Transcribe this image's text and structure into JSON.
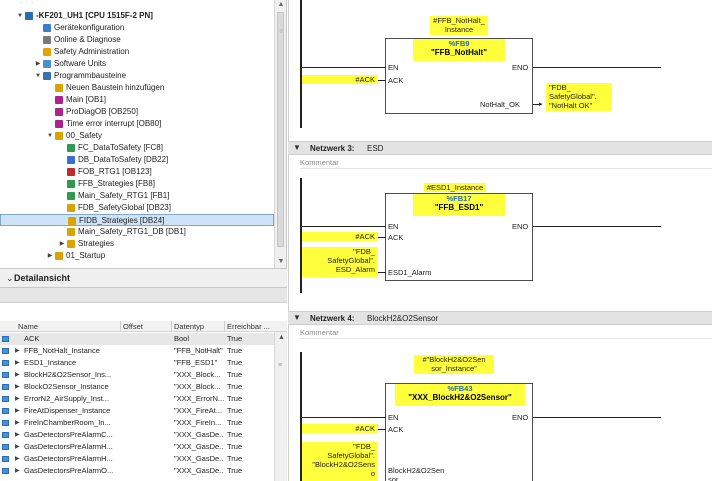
{
  "tree": {
    "items": [
      {
        "label": "-KF201_UH1 [CPU 1515F-2 PN]",
        "indent": 0,
        "twisty": "▼",
        "icon": "cpu-icon",
        "color": "#2c6bb0",
        "bold": true
      },
      {
        "label": "Gerätekonfiguration",
        "indent": 1,
        "twisty": "",
        "icon": "device-config-icon",
        "color": "#3a7fc8"
      },
      {
        "label": "Online & Diagnose",
        "indent": 1,
        "twisty": "",
        "icon": "online-diagnose-icon",
        "color": "#7a7a7a"
      },
      {
        "label": "Safety Administration",
        "indent": 1,
        "twisty": "",
        "icon": "safety-admin-icon",
        "color": "#e6a400"
      },
      {
        "label": "Software Units",
        "indent": 1,
        "twisty": "▶",
        "icon": "software-units-icon",
        "color": "#4a8ed6"
      },
      {
        "label": "Programmbausteine",
        "indent": 1,
        "twisty": "▼",
        "icon": "program-blocks-icon",
        "color": "#3a6fb0"
      },
      {
        "label": "Neuen Baustein hinzufügen",
        "indent": 2,
        "twisty": "",
        "icon": "add-block-icon",
        "color": "#d9a400"
      },
      {
        "label": "Main [OB1]",
        "indent": 2,
        "twisty": "",
        "icon": "ob-block-icon",
        "color": "#b0208f"
      },
      {
        "label": "ProDiagOB [OB250]",
        "indent": 2,
        "twisty": "",
        "icon": "ob-block-icon",
        "color": "#b0208f"
      },
      {
        "label": "Time error interrupt [OB80]",
        "indent": 2,
        "twisty": "",
        "icon": "ob-block-icon",
        "color": "#b0208f"
      },
      {
        "label": "00_Safety",
        "indent": 2,
        "twisty": "▼",
        "icon": "folder-icon",
        "color": "#d9a400"
      },
      {
        "label": "FC_DataToSafety [FC8]",
        "indent": 3,
        "twisty": "",
        "icon": "fc-block-icon",
        "color": "#2f9a4f"
      },
      {
        "label": "DB_DataToSafety [DB22]",
        "indent": 3,
        "twisty": "",
        "icon": "db-block-icon",
        "color": "#3a6fd0"
      },
      {
        "label": "FOB_RTG1 [OB123]",
        "indent": 3,
        "twisty": "",
        "icon": "fob-block-icon",
        "color": "#c02a2a"
      },
      {
        "label": "FFB_Strategies [FB8]",
        "indent": 3,
        "twisty": "",
        "icon": "fb-block-icon",
        "color": "#2f9a4f"
      },
      {
        "label": "Main_Safety_RTG1 [FB1]",
        "indent": 3,
        "twisty": "",
        "icon": "fb-block-icon",
        "color": "#2f9a4f"
      },
      {
        "label": "FDB_SafetyGlobal [DB23]",
        "indent": 3,
        "twisty": "",
        "icon": "db-block-icon",
        "color": "#d9a400"
      },
      {
        "label": "FIDB_Strategies [DB24]",
        "indent": 3,
        "twisty": "",
        "icon": "db-block-icon",
        "color": "#d9a400",
        "selected": true
      },
      {
        "label": "Main_Safety_RTG1_DB [DB1]",
        "indent": 3,
        "twisty": "",
        "icon": "db-block-icon",
        "color": "#d9a400"
      },
      {
        "label": "Strategies",
        "indent": 3,
        "twisty": "▶",
        "icon": "folder-icon",
        "color": "#d9a400"
      },
      {
        "label": "01_Startup",
        "indent": 2,
        "twisty": "▶",
        "icon": "folder-icon",
        "color": "#d9a400"
      }
    ]
  },
  "details": {
    "title": "Detailansicht",
    "columns": [
      "Name",
      "Offset",
      "Datentyp",
      "Erreichbar ..."
    ],
    "rows": [
      {
        "name": "ACK",
        "offset": "",
        "type": "Bool",
        "reach": "True",
        "expandable": false
      },
      {
        "name": "FFB_NotHalt_Instance",
        "offset": "",
        "type": "\"FFB_NotHalt\"",
        "reach": "True",
        "expandable": true
      },
      {
        "name": "ESD1_Instance",
        "offset": "",
        "type": "\"FFB_ESD1\"",
        "reach": "True",
        "expandable": true
      },
      {
        "name": "BlockH2&O2Sensor_Ins...",
        "offset": "",
        "type": "\"XXX_Block...",
        "reach": "True",
        "expandable": true
      },
      {
        "name": "BlockO2Sensor_Instance",
        "offset": "",
        "type": "\"XXX_Block...",
        "reach": "True",
        "expandable": true
      },
      {
        "name": "ErrorN2_AirSupply_Inst...",
        "offset": "",
        "type": "\"XXX_ErrorN...",
        "reach": "True",
        "expandable": true
      },
      {
        "name": "FireAtDispenser_Instance",
        "offset": "",
        "type": "\"XXX_FireAt...",
        "reach": "True",
        "expandable": true
      },
      {
        "name": "FireInChamberRoom_In...",
        "offset": "",
        "type": "\"XXX_FireIn...",
        "reach": "True",
        "expandable": true
      },
      {
        "name": "GasDetectorsPreAlarmC...",
        "offset": "",
        "type": "\"XXX_GasDe...",
        "reach": "True",
        "expandable": true
      },
      {
        "name": "GasDetectorsPreAlarmH...",
        "offset": "",
        "type": "\"XXX_GasDe...",
        "reach": "True",
        "expandable": true
      },
      {
        "name": "GasDetectorsPreAlarmH...",
        "offset": "",
        "type": "\"XXX_GasDe...",
        "reach": "True",
        "expandable": true
      },
      {
        "name": "GasDetectorsPreAlarmO...",
        "offset": "",
        "type": "\"XXX_GasDe...",
        "reach": "True",
        "expandable": true
      }
    ]
  },
  "editor": {
    "net2": {
      "instance": "#FFB_NotHalt_\nInstance",
      "fb_num": "%FB9",
      "fb_name": "\"FFB_NotHalt\"",
      "en": "EN",
      "eno": "ENO",
      "ack_pin": "ACK",
      "ack_param": "#ACK",
      "out_pin": "NotHalt_OK",
      "out_param": "\"FDB_\nSafetyGlobal\".\n\"NotHalt OK\""
    },
    "net3": {
      "number": "Netzwerk 3:",
      "name": "ESD",
      "comment": "Kommentar",
      "instance": "#ESD1_Instance",
      "fb_num": "%FB17",
      "fb_name": "\"FFB_ESD1\"",
      "en": "EN",
      "eno": "ENO",
      "ack_pin": "ACK",
      "ack_param": "#ACK",
      "alarm_pin": "ESD1_Alarm",
      "alarm_param": "\"FDB_\nSafetyGlobal\".\nESD_Alarm"
    },
    "net4": {
      "number": "Netzwerk 4:",
      "name": "BlockH2&O2Sensor",
      "comment": "Kommentar",
      "instance": "#\"BlockH2&O2Sen\nsor_Instance\"",
      "fb_num": "%FB43",
      "fb_name": "\"XXX_BlockH2&O2Sensor\"",
      "en": "EN",
      "eno": "ENO",
      "ack_pin": "ACK",
      "ack_param": "#ACK",
      "sensor_pin": "BlockH2&O2Sen\nsor",
      "sensor_param": "\"FDB_\nSafetyGlobal\".\n\"BlockH2&O2Sens\no"
    }
  },
  "colors": {
    "highlight": "#ffff3c",
    "selected_row": "#cfe3f7",
    "fb_number": "#2a6cb0"
  }
}
